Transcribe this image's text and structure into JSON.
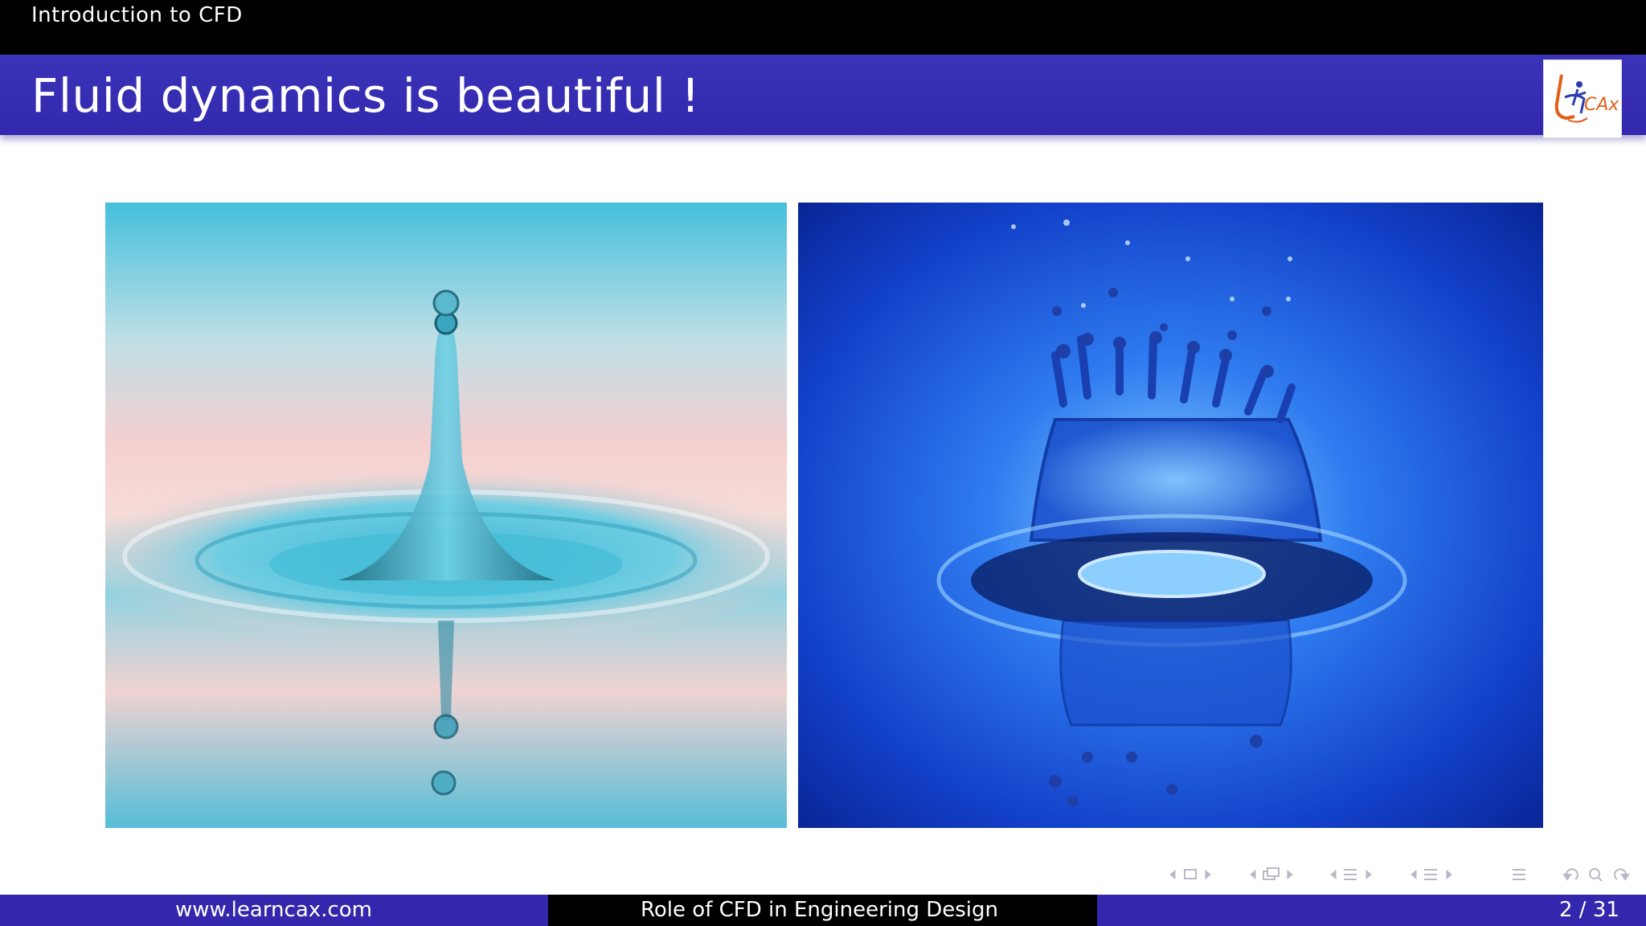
{
  "header": {
    "section_title": "Introduction to CFD",
    "frame_title": "Fluid dynamics is beautiful !",
    "logo_text": "CAx"
  },
  "images": [
    {
      "name": "water-drop-splash-photo",
      "colors": [
        "#4cc3e3",
        "#f3cfcf",
        "#45b8d4"
      ]
    },
    {
      "name": "water-crown-splash-photo",
      "colors": [
        "#1f52d9",
        "#5aa8ff",
        "#0c2a9b"
      ]
    }
  ],
  "nav_icons": [
    "nav-frame-icon",
    "nav-subsection-icon",
    "nav-section-icon",
    "nav-doc-icon",
    "search-icon"
  ],
  "footer": {
    "left": "www.learncax.com",
    "center": "Role of CFD in Engineering Design",
    "right": "2 / 31"
  },
  "colors": {
    "theme_blue": "#3328ad",
    "black": "#000000"
  }
}
